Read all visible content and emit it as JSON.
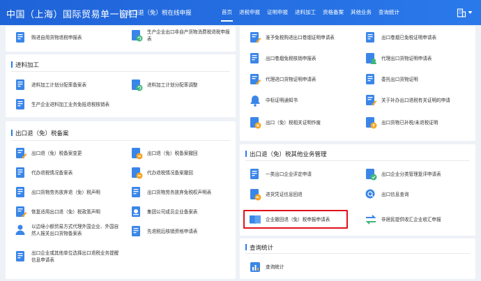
{
  "header": {
    "brand": "中国（上海）国际贸易单一窗口",
    "subtitle": "出口退（免）税在线申报",
    "nav": [
      "首页",
      "退税申报",
      "证明申报",
      "进料加工",
      "资格备案",
      "其他业务",
      "查询统计"
    ],
    "active_nav": "首页",
    "icons": {
      "user": "building-user-icon",
      "caret": "caret-down-icon"
    }
  },
  "left": {
    "top_items": [
      "购进自用货物退税申报表",
      "生产企业出口非自产货物消费税退税申报表"
    ],
    "jinliao": {
      "title": "进料加工",
      "items": [
        "进料加工计划分配率备案表",
        "进料加工计划分配率调整",
        "生产企业进料加工业务免抵退税核销表"
      ]
    },
    "beian": {
      "title": "出口退（免）税备案",
      "items": [
        "出口退（免）税备案变更",
        "出口退（免）税备案撤回",
        "代办退税情况备案表",
        "代办退税情况备案撤回",
        "出口货物劳务放弃退（免）税声明",
        "出口货物劳务放弃免税权声明表",
        "恢复适用出口退（免）税政策声明",
        "集团公司成员企业备案表",
        "以边境小额贸易方式代理外国企业、外国自然人报关出口货物备案表",
        "先退税后核销资格申请表",
        "出口企业或其他单位选择出口退税业务提醒信息申请表"
      ]
    }
  },
  "right": {
    "top_items": [
      "准予免税购进出口卷烟证明申请表",
      "出口卷烟已免税证明申请表",
      "出口卷烟免税核销申报表",
      "代理出口货物证明申请表",
      "代理进口货物证明申请表",
      "委托出口货物证明",
      "中标证明通知书",
      "关于补办出口退税有关证明的申请",
      "出口（免）税相关证明作废",
      "出口货物已补税/未退税证明"
    ],
    "other": {
      "title": "出口退（免）税其他业务管理",
      "items": [
        "一类出口企业评定申请",
        "出口企业分类管理复评申请表",
        "进货凭证信息回退",
        "出口信息查询",
        "企业撤回退（免）税申报申请表",
        "非居民提供收汇企业收汇申报"
      ]
    },
    "query": {
      "title": "查询统计",
      "items": [
        "查询统计"
      ]
    }
  },
  "colors": {
    "header_blue": "#2a79ea",
    "highlight_red": "#e3101b",
    "icon_blue": "#3a86e8",
    "icon_green": "#3fb57a",
    "icon_orange": "#f5a623"
  }
}
